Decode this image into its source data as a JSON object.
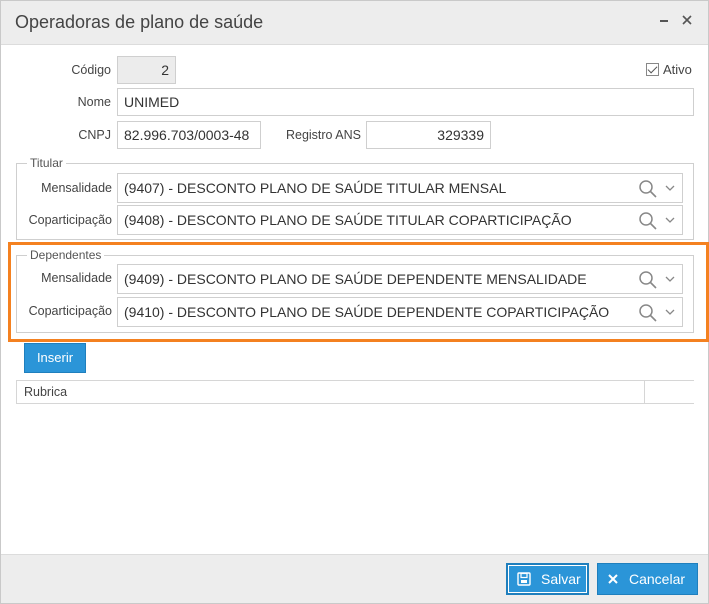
{
  "window": {
    "title": "Operadoras de plano de saúde",
    "minimize_icon": "minimize-icon",
    "close_icon": "close-icon"
  },
  "form": {
    "codigo": {
      "label": "Código",
      "value": "2"
    },
    "ativo": {
      "label": "Ativo",
      "checked": true
    },
    "nome": {
      "label": "Nome",
      "value": "UNIMED"
    },
    "cnpj": {
      "label": "CNPJ",
      "value": "82.996.703/0003-48"
    },
    "registro_ans": {
      "label": "Registro ANS",
      "value": "329339"
    }
  },
  "titular": {
    "legend": "Titular",
    "mensalidade": {
      "label": "Mensalidade",
      "value": "(9407) - DESCONTO PLANO DE SAÚDE TITULAR MENSAL"
    },
    "coparticipacao": {
      "label": "Coparticipação",
      "value": "(9408) - DESCONTO PLANO DE SAÚDE TITULAR COPARTICIPAÇÃO"
    }
  },
  "dependentes": {
    "legend": "Dependentes",
    "mensalidade": {
      "label": "Mensalidade",
      "value": "(9409) - DESCONTO PLANO DE SAÚDE DEPENDENTE MENSALIDADE"
    },
    "coparticipacao": {
      "label": "Coparticipação",
      "value": "(9410) - DESCONTO PLANO DE SAÚDE DEPENDENTE COPARTICIPAÇÃO"
    }
  },
  "grid": {
    "insert_label": "Inserir",
    "columns": [
      "Rubrica",
      ""
    ]
  },
  "footer": {
    "save_label": "Salvar",
    "cancel_label": "Cancelar"
  },
  "colors": {
    "accent": "#2b95d8",
    "highlight": "#f48120",
    "titlebar": "#ededed"
  }
}
